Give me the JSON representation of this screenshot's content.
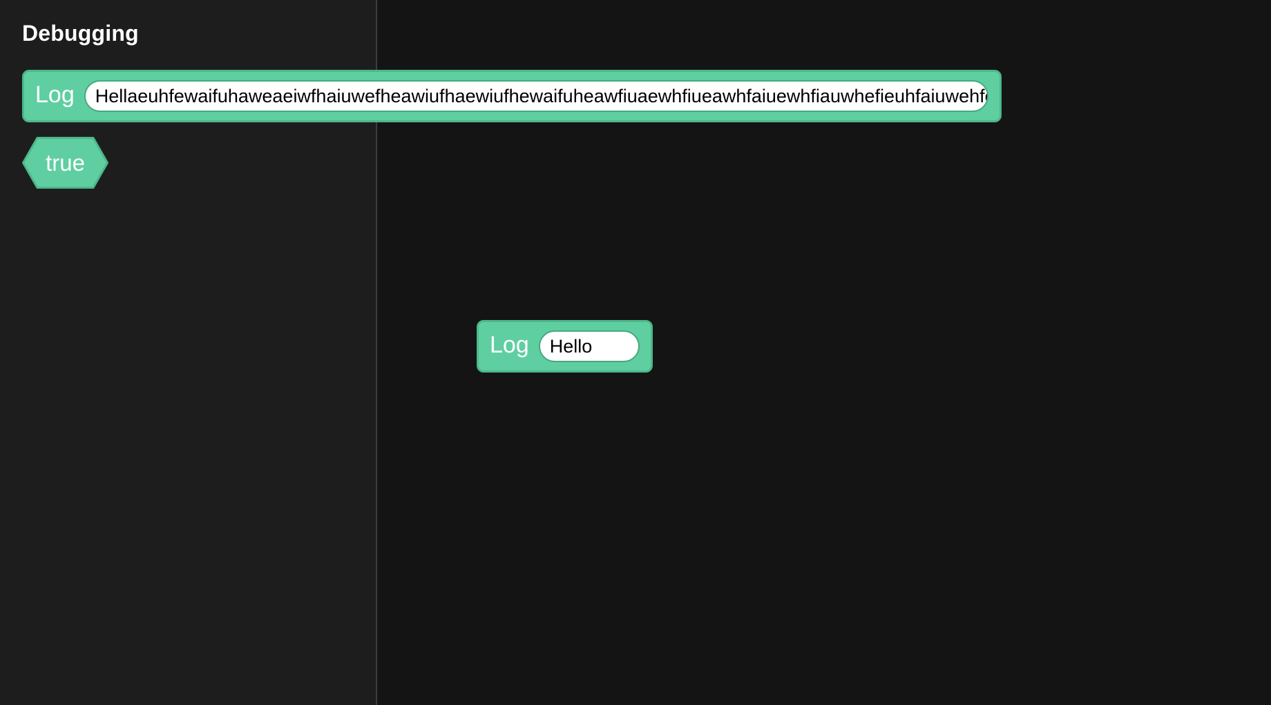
{
  "palette": {
    "category_title": "Debugging",
    "log_block": {
      "label": "Log",
      "value": "Hellaeuhfewaifuhaweaeiwfhaiuwefheawiufhaewiufhewaifuheawfiuaewhfiueawhfaiuewhfiauwhefieuhfaiuwehfo"
    },
    "boolean_block": {
      "label": "true"
    }
  },
  "workspace": {
    "log_block": {
      "label": "Log",
      "value": "Hello"
    }
  },
  "colors": {
    "block_fill": "#5fcfa1",
    "block_border": "#4cb78b",
    "sidebar_bg": "#1d1d1d",
    "workspace_bg": "#141414"
  }
}
